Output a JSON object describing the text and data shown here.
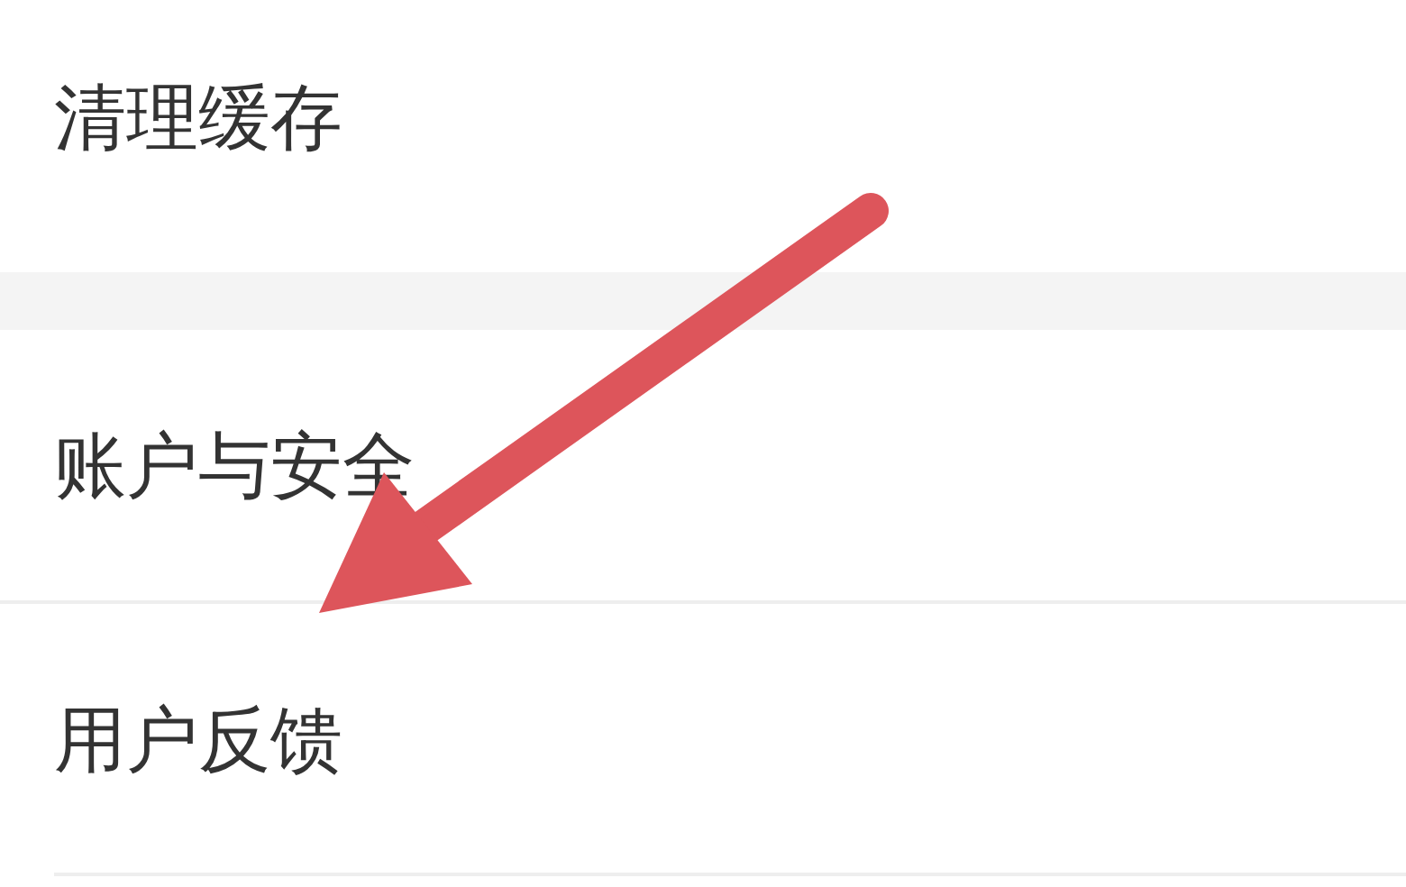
{
  "sections": [
    {
      "items": [
        {
          "label": "清理缓存"
        }
      ]
    },
    {
      "items": [
        {
          "label": "账户与安全"
        },
        {
          "label": "用户反馈"
        }
      ]
    }
  ]
}
